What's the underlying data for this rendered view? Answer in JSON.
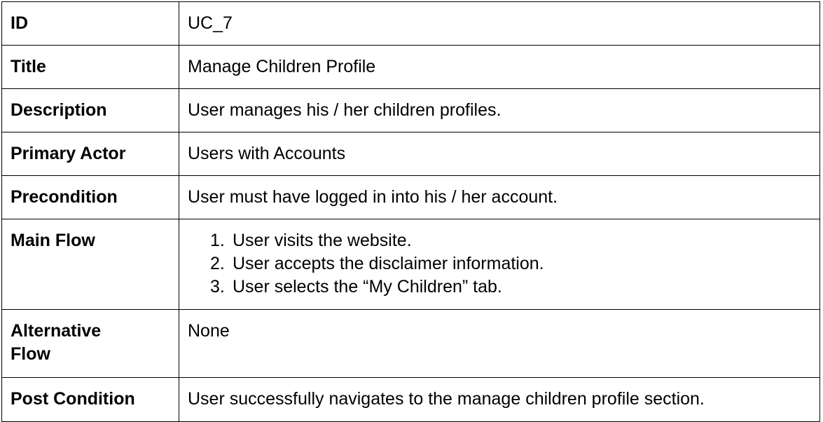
{
  "rows": [
    {
      "label": "ID",
      "value": "UC_7"
    },
    {
      "label": "Title",
      "value": "Manage Children Profile"
    },
    {
      "label": "Description",
      "value": "User manages his / her children profiles."
    },
    {
      "label": "Primary Actor",
      "value": "Users with Accounts"
    },
    {
      "label": "Precondition",
      "value": "User must have logged in into his / her account."
    }
  ],
  "main_flow": {
    "label": "Main Flow",
    "steps": [
      {
        "num": "1.",
        "text": "User visits the website."
      },
      {
        "num": "2.",
        "text": "User accepts the disclaimer information."
      },
      {
        "num": "3.",
        "text": "User selects the “My Children” tab."
      }
    ]
  },
  "alternative_flow": {
    "label_line1": "Alternative",
    "label_line2": "Flow",
    "value": "None"
  },
  "post_condition": {
    "label": "Post Condition",
    "value": "User successfully navigates to the manage children profile section."
  }
}
